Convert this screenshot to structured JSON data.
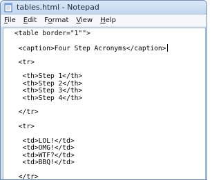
{
  "window": {
    "title": "tables.html - Notepad",
    "icon": "notepad-icon"
  },
  "menubar": {
    "items": [
      {
        "mnemonic": "F",
        "rest": "ile"
      },
      {
        "mnemonic": "E",
        "rest": "dit"
      },
      {
        "mnemonic": "o",
        "prefix": "F",
        "rest": "rmat"
      },
      {
        "mnemonic": "V",
        "rest": "iew"
      },
      {
        "mnemonic": "H",
        "rest": "elp"
      }
    ]
  },
  "editor": {
    "lines": [
      "<table border=\"1\"\">",
      "",
      " <caption>Four Step Acronyms</caption>",
      "",
      " <tr>",
      "",
      "  <th>Step 1</th>",
      "  <th>Step 2</th>",
      "  <th>Step 3</th>",
      "  <th>Step 4</th>",
      "",
      " </tr>",
      "",
      " <tr>",
      "",
      "  <td>LOL!</td>",
      "  <td>OMG!</td>",
      "  <td>WTF?</td>",
      "  <td>BBQ!</td>",
      "",
      " </tr>"
    ]
  }
}
